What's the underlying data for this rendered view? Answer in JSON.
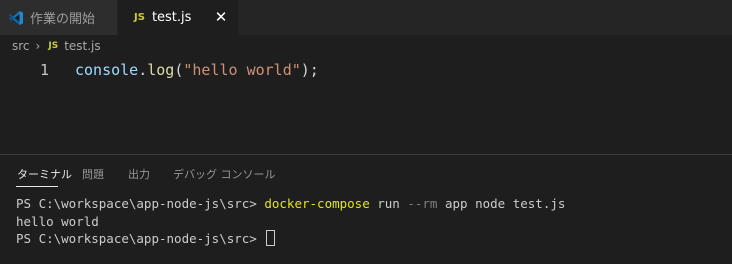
{
  "tabs": [
    {
      "label": "作業の開始",
      "icon": "vscode-icon",
      "active": false
    },
    {
      "label": "test.js",
      "icon": "js-file-icon",
      "badge": "JS",
      "active": true,
      "close": "✕"
    }
  ],
  "breadcrumb": {
    "folder": "src",
    "separator": "›",
    "badge": "JS",
    "file": "test.js"
  },
  "editor": {
    "line_number": "1",
    "tokens": {
      "obj": "console",
      "dot": ".",
      "fn": "log",
      "open": "(",
      "str": "\"hello world\"",
      "close": ");"
    }
  },
  "panel": {
    "tabs": [
      "ターミナル",
      "問題",
      "出力",
      "デバッグ コンソール"
    ],
    "active_tab": "ターミナル"
  },
  "terminal": {
    "prompt": "PS C:\\workspace\\app-node-js\\src> ",
    "command": "docker-compose",
    "arg1": " run ",
    "flag": "--rm",
    "rest": " app node test.js",
    "output": "hello world",
    "prompt2": "PS C:\\workspace\\app-node-js\\src> "
  },
  "colors": {
    "accent_vscode": "#23a9f2",
    "js_badge": "#cbcb41"
  }
}
